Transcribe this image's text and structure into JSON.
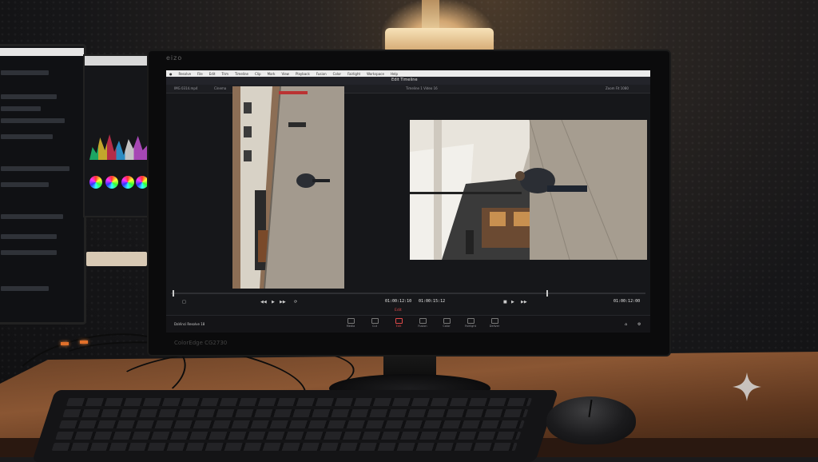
{
  "monitor": {
    "logo_text": "eizo",
    "brand_text": "ColorEdge CG2730"
  },
  "app": {
    "menu": [
      "Resolve",
      "File",
      "Edit",
      "Trim",
      "Timeline",
      "Clip",
      "Mark",
      "View",
      "Playback",
      "Fusion",
      "Color",
      "Fairlight",
      "Workspace",
      "Help"
    ],
    "window_title": "Edit Timeline",
    "viewer_bar": {
      "left_clip": "IMG 0314.mp4",
      "left_mode": "Cinema",
      "left_timecode_label": "Timeline",
      "center_label": "Timeline 1 Video 16",
      "right_zoom": "Zoom Fit 1080"
    },
    "source_timecode": "01:00:12:10",
    "record_timecode": "01:00:15:12",
    "right_timecode": "01:00:12:00",
    "edit_mode_label": "Edit",
    "status_text": "DaVinci Resolve 18",
    "page_tabs": [
      "Media",
      "Cut",
      "Edit",
      "Fusion",
      "Color",
      "Fairlight",
      "Deliver"
    ],
    "active_page_tab": "Edit"
  },
  "colors": {
    "accent_red": "#e04a4a",
    "led_orange": "#e2702a",
    "desk_wood": "#8a5633"
  }
}
